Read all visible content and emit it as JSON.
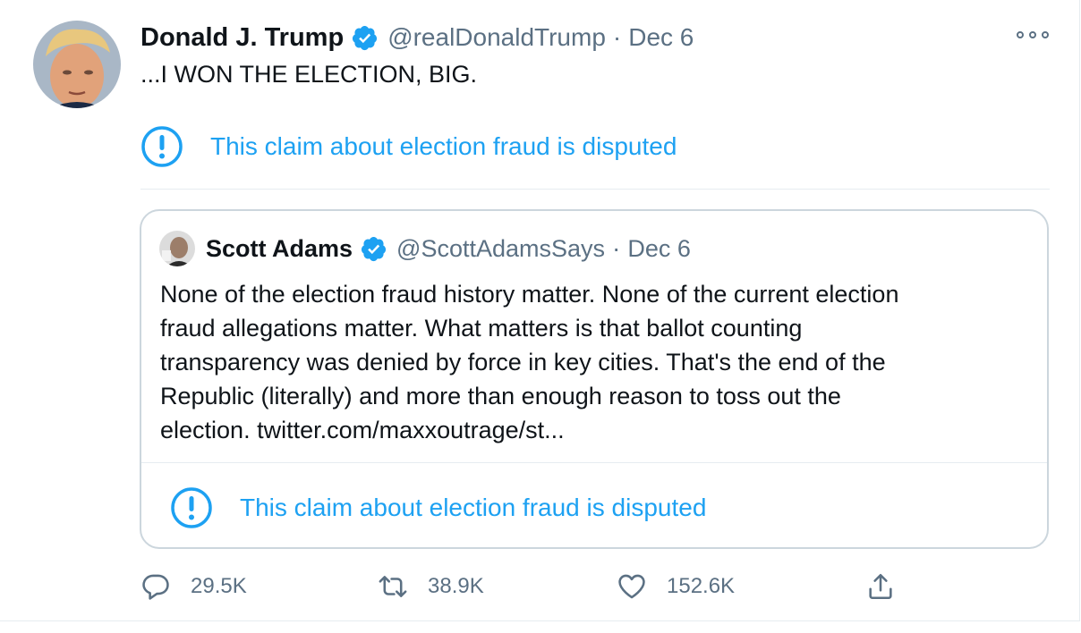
{
  "tweet": {
    "author_name": "Donald J. Trump",
    "handle": "@realDonaldTrump",
    "separator": "·",
    "date": "Dec 6",
    "text": "...I WON THE ELECTION, BIG.",
    "notice": "This claim about election fraud is disputed"
  },
  "quote": {
    "author_name": "Scott Adams",
    "handle": "@ScottAdamsSays",
    "separator": "·",
    "date": "Dec 6",
    "lines": [
      "None of the election fraud history matter. None of the current election",
      "fraud allegations matter. What matters is that ballot counting",
      "transparency was denied by force in key cities. That's the end of the",
      "Republic (literally) and more than enough reason to toss out the",
      "election. twitter.com/maxxoutrage/st..."
    ],
    "notice": "This claim about election fraud is disputed"
  },
  "actions": {
    "reply_count": "29.5K",
    "retweet_count": "38.9K",
    "like_count": "152.6K"
  },
  "icons": {
    "verified": "verified-badge-icon",
    "notice": "exclamation-circle-icon",
    "more": "more-options-icon",
    "reply": "reply-icon",
    "retweet": "retweet-icon",
    "like": "heart-icon",
    "share": "share-icon"
  },
  "colors": {
    "accent": "#1da1f2",
    "secondary_text": "#5b7083",
    "border": "#ccd6dd"
  }
}
